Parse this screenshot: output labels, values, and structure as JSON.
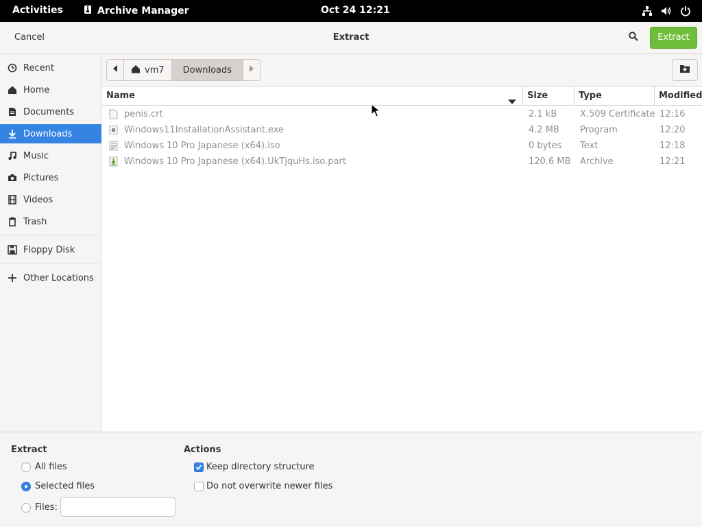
{
  "topbar": {
    "activities": "Activities",
    "app_name": "Archive Manager",
    "clock": "Oct 24  12:21"
  },
  "header": {
    "cancel": "Cancel",
    "title": "Extract",
    "extract": "Extract"
  },
  "sidebar": {
    "items": [
      {
        "label": "Recent",
        "icon": "clock-icon"
      },
      {
        "label": "Home",
        "icon": "home-icon"
      },
      {
        "label": "Documents",
        "icon": "document-icon"
      },
      {
        "label": "Downloads",
        "icon": "download-icon"
      },
      {
        "label": "Music",
        "icon": "music-icon"
      },
      {
        "label": "Pictures",
        "icon": "camera-icon"
      },
      {
        "label": "Videos",
        "icon": "film-icon"
      },
      {
        "label": "Trash",
        "icon": "trash-icon"
      },
      {
        "label": "Floppy Disk",
        "icon": "floppy-icon"
      },
      {
        "label": "Other Locations",
        "icon": "plus-icon"
      }
    ],
    "active": "Downloads"
  },
  "path": {
    "home": "vm7",
    "current": "Downloads"
  },
  "columns": {
    "name": "Name",
    "size": "Size",
    "type": "Type",
    "modified": "Modified"
  },
  "files": [
    {
      "name": "penis.crt",
      "size": "2.1 kB",
      "type": "X.509 Certificate",
      "modified": "12:16",
      "icon": "certificate-file-icon"
    },
    {
      "name": "Windows11InstallationAssistant.exe",
      "size": "4.2 MB",
      "type": "Program",
      "modified": "12:20",
      "icon": "executable-file-icon"
    },
    {
      "name": "Windows 10 Pro Japanese (x64).iso",
      "size": "0 bytes",
      "type": "Text",
      "modified": "12:18",
      "icon": "text-file-icon"
    },
    {
      "name": "Windows 10 Pro Japanese (x64).UkTjquHs.iso.part",
      "size": "120.6 MB",
      "type": "Archive",
      "modified": "12:21",
      "icon": "archive-file-icon"
    }
  ],
  "options": {
    "extract_title": "Extract",
    "all_files": "All files",
    "selected_files": "Selected files",
    "files_label": "Files:",
    "files_value": "",
    "actions_title": "Actions",
    "keep_structure": "Keep directory structure",
    "no_overwrite": "Do not overwrite newer files"
  },
  "colors": {
    "accent": "#3584e4",
    "extract_button": "#6ebe3c"
  }
}
